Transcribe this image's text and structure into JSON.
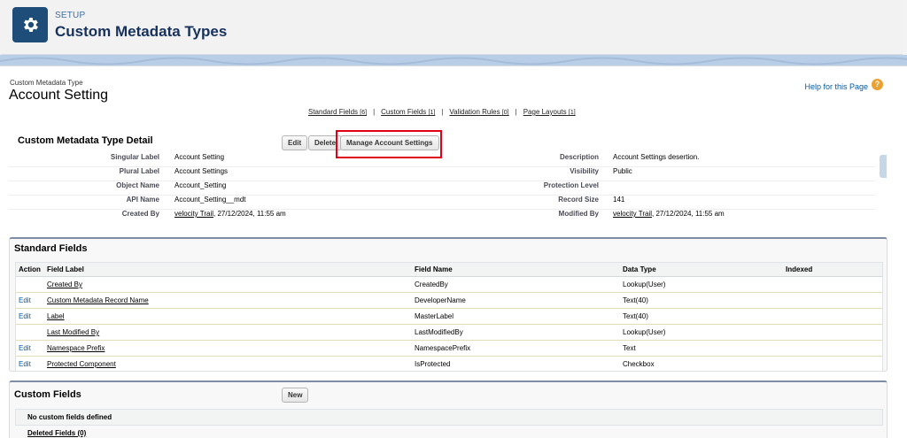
{
  "header": {
    "eyebrow": "SETUP",
    "title": "Custom Metadata Types",
    "icon": "gear-icon"
  },
  "page": {
    "eyebrow": "Custom Metadata Type",
    "title": "Account Setting",
    "help_link": "Help for this Page",
    "help_icon": "?"
  },
  "related_links": [
    {
      "label": "Standard Fields",
      "count": "[6]"
    },
    {
      "label": "Custom Fields",
      "count": "[1]"
    },
    {
      "label": "Validation Rules",
      "count": "[0]"
    },
    {
      "label": "Page Layouts",
      "count": "[1]"
    }
  ],
  "related_sep": "|",
  "detail": {
    "title": "Custom Metadata Type Detail",
    "buttons": {
      "edit": "Edit",
      "delete": "Delete",
      "manage": "Manage Account Settings"
    },
    "rows": [
      {
        "l1": "Singular Label",
        "v1": "Account Setting",
        "l2": "Description",
        "v2": "Account Settings desertion."
      },
      {
        "l1": "Plural Label",
        "v1": "Account Settings",
        "l2": "Visibility",
        "v2": "Public"
      },
      {
        "l1": "Object Name",
        "v1": "Account_Setting",
        "l2": "Protection Level",
        "v2": ""
      },
      {
        "l1": "API Name",
        "v1": "Account_Setting__mdt",
        "l2": "Record Size",
        "v2": "141"
      },
      {
        "l1": "Created By",
        "v1_link": "velocity Trail",
        "v1_rest": ", 27/12/2024, 11:55 am",
        "l2": "Modified By",
        "v2_link": "velocity Trail",
        "v2_rest": ", 27/12/2024, 11:55 am"
      }
    ]
  },
  "standard_fields": {
    "title": "Standard Fields",
    "columns": [
      "Action",
      "Field Label",
      "Field Name",
      "Data Type",
      "Indexed"
    ],
    "rows": [
      {
        "action": "",
        "label": "Created By",
        "name": "CreatedBy",
        "type": "Lookup(User)"
      },
      {
        "action": "Edit",
        "label": "Custom Metadata Record Name",
        "name": "DeveloperName",
        "type": "Text(40)"
      },
      {
        "action": "Edit",
        "label": "Label",
        "name": "MasterLabel",
        "type": "Text(40)"
      },
      {
        "action": "",
        "label": "Last Modified By",
        "name": "LastModifiedBy",
        "type": "Lookup(User)"
      },
      {
        "action": "Edit",
        "label": "Namespace Prefix",
        "name": "NamespacePrefix",
        "type": "Text"
      },
      {
        "action": "Edit",
        "label": "Protected Component",
        "name": "IsProtected",
        "type": "Checkbox"
      }
    ]
  },
  "custom_fields": {
    "title": "Custom Fields",
    "new_button": "New",
    "empty_text": "No custom fields defined",
    "deleted_link": "Deleted Fields (0)"
  },
  "colors": {
    "brand": "#1f4d79",
    "link": "#015ba7",
    "highlight": "#e0001a",
    "help": "#e9a132"
  }
}
